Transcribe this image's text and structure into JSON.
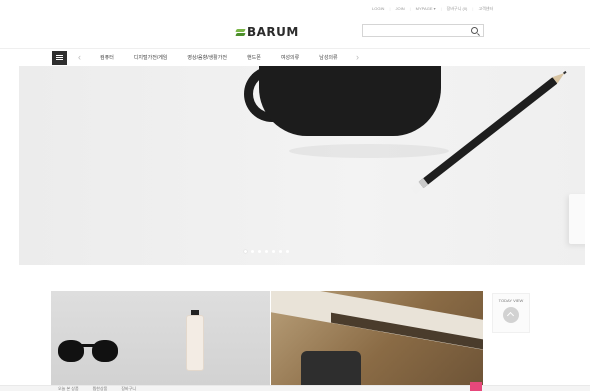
{
  "header": {
    "util_links": [
      "LOGIN",
      "JOIN",
      "MYPAGE ▾",
      "장바구니 (0)",
      "고객센터"
    ],
    "logo_text": "BARUM",
    "search": {
      "placeholder": "",
      "value": ""
    }
  },
  "nav": {
    "items": [
      "컴퓨터",
      "디지털가전/게임",
      "영상/음향/생활가전",
      "핸드폰",
      "여성의류",
      "남성의류"
    ],
    "prev_icon": "chevron-left-icon",
    "next_icon": "chevron-right-icon"
  },
  "hero": {
    "slide_count": 7,
    "active_index": 0
  },
  "sidebar": {
    "today_view_label": "TODAY VIEW"
  },
  "bottom_bar": {
    "tabs": [
      "오늘 본 상품",
      "찜한상품",
      "장바구니"
    ]
  },
  "colors": {
    "logo_green": "#7ab648",
    "accent_pink": "#e6487b",
    "nav_dark": "#2f2f2f"
  }
}
